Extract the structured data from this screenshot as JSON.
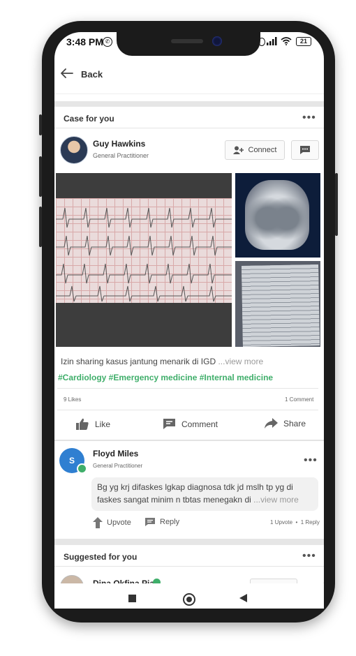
{
  "status_bar": {
    "time": "3:48 PM",
    "battery": "21"
  },
  "topbar": {
    "back_label": "Back"
  },
  "case_section": {
    "title": "Case for you"
  },
  "post": {
    "author_name": "Guy Hawkins",
    "author_role": "General Practitioner",
    "connect_label": "Connect",
    "text": "Izin sharing kasus jantung menarik di IGD",
    "view_more": "...view more",
    "hashtags": "#Cardiology #Emergency medicine #Internal medicine",
    "likes_count": "9 Likes",
    "comments_count": "1 Comment",
    "actions": {
      "like": "Like",
      "comment": "Comment",
      "share": "Share"
    }
  },
  "comment": {
    "avatar_initial": "S",
    "author_name": "Floyd Miles",
    "author_role": "General Practitioner",
    "text": "Bg yg krj difaskes lgkap diagnosa tdk jd mslh tp yg di faskes sangat minim n tbtas menegakn di",
    "view_more": "...view more",
    "upvote_label": "Upvote",
    "reply_label": "Reply",
    "stats": "1 Upvote  •  1 Reply"
  },
  "suggested_section": {
    "title": "Suggested for you",
    "first_name": "Dina Okfina Pia"
  },
  "colors": {
    "accent_green": "#3fae6a",
    "avatar_blue": "#2f7fd1"
  }
}
